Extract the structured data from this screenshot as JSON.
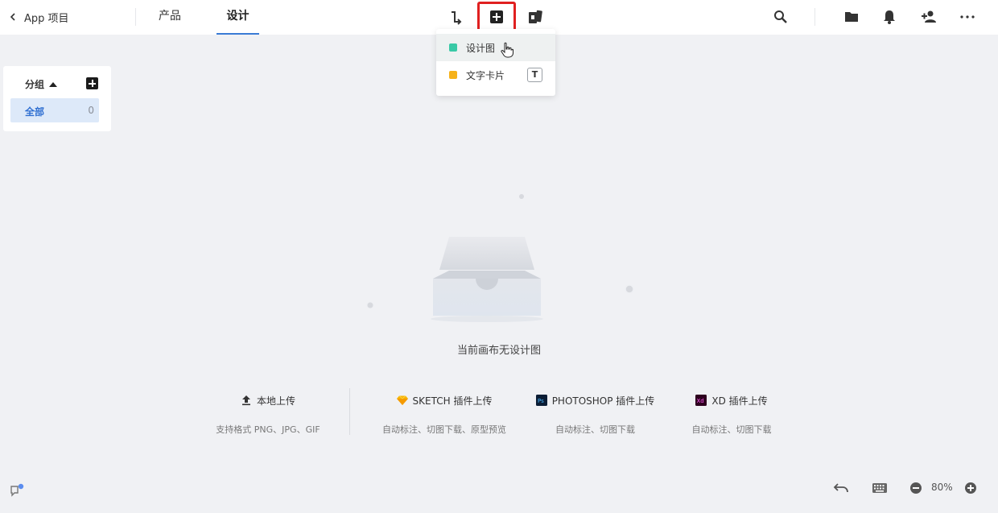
{
  "header": {
    "back_label": "App 项目",
    "tabs": [
      {
        "label": "产品",
        "active": false
      },
      {
        "label": "设计",
        "active": true
      }
    ],
    "accent_color": "#3a7bd5",
    "highlight_color": "#e02020",
    "center_icons": [
      "connector-icon",
      "add-square-icon",
      "card-stack-icon"
    ],
    "right_icons": [
      "search-icon",
      "folder-icon",
      "bell-icon",
      "add-user-icon",
      "more-icon"
    ]
  },
  "dropdown": {
    "items": [
      {
        "label": "设计图",
        "swatch": "#39c9a6",
        "shortcut": ""
      },
      {
        "label": "文字卡片",
        "swatch": "#f6b21a",
        "shortcut": "T"
      }
    ]
  },
  "groups": {
    "title": "分组",
    "items": [
      {
        "label": "全部",
        "count": "0"
      }
    ]
  },
  "empty_state": {
    "text": "当前画布无设计图"
  },
  "uploads": [
    {
      "title": "本地上传",
      "desc": "支持格式 PNG、JPG、GIF",
      "icon": "upload-icon"
    },
    {
      "title": "SKETCH 插件上传",
      "desc": "自动标注、切图下载、原型预览",
      "icon": "sketch-icon"
    },
    {
      "title": "PHOTOSHOP 插件上传",
      "desc": "自动标注、切图下载",
      "icon": "photoshop-icon"
    },
    {
      "title": "XD 插件上传",
      "desc": "自动标注、切图下载",
      "icon": "xd-icon"
    }
  ],
  "bottom": {
    "zoom": "80%",
    "icons": [
      "undo-icon",
      "keyboard-icon",
      "zoom-out-icon",
      "zoom-in-icon"
    ]
  }
}
